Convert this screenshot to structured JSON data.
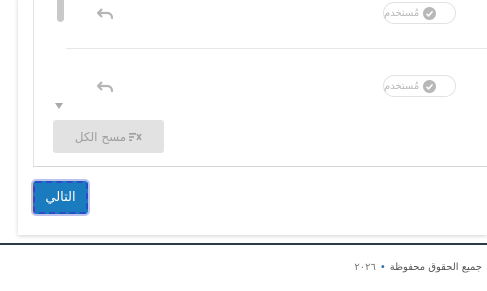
{
  "rows": [
    {
      "status_label": "مُستخدم"
    },
    {
      "status_label": "مُستخدم"
    }
  ],
  "clear_all_label": "مسح الكل",
  "next_button_label": "التالي",
  "footer": {
    "rights_text": "جميع الحقوق محفوظة",
    "separator": "•",
    "year": "٢٠٢٦"
  },
  "icons": {
    "row_action": "undo-icon",
    "status_check": "check-circle-icon",
    "clear_all": "clear-all-icon",
    "scroll_down": "scroll-down-arrow-icon"
  },
  "colors": {
    "primary_button": "#1a7bbf",
    "focus_outline": "#2a4cc9",
    "disabled_button": "#e2e2e2",
    "footer_dot": "#2b6fb3"
  }
}
